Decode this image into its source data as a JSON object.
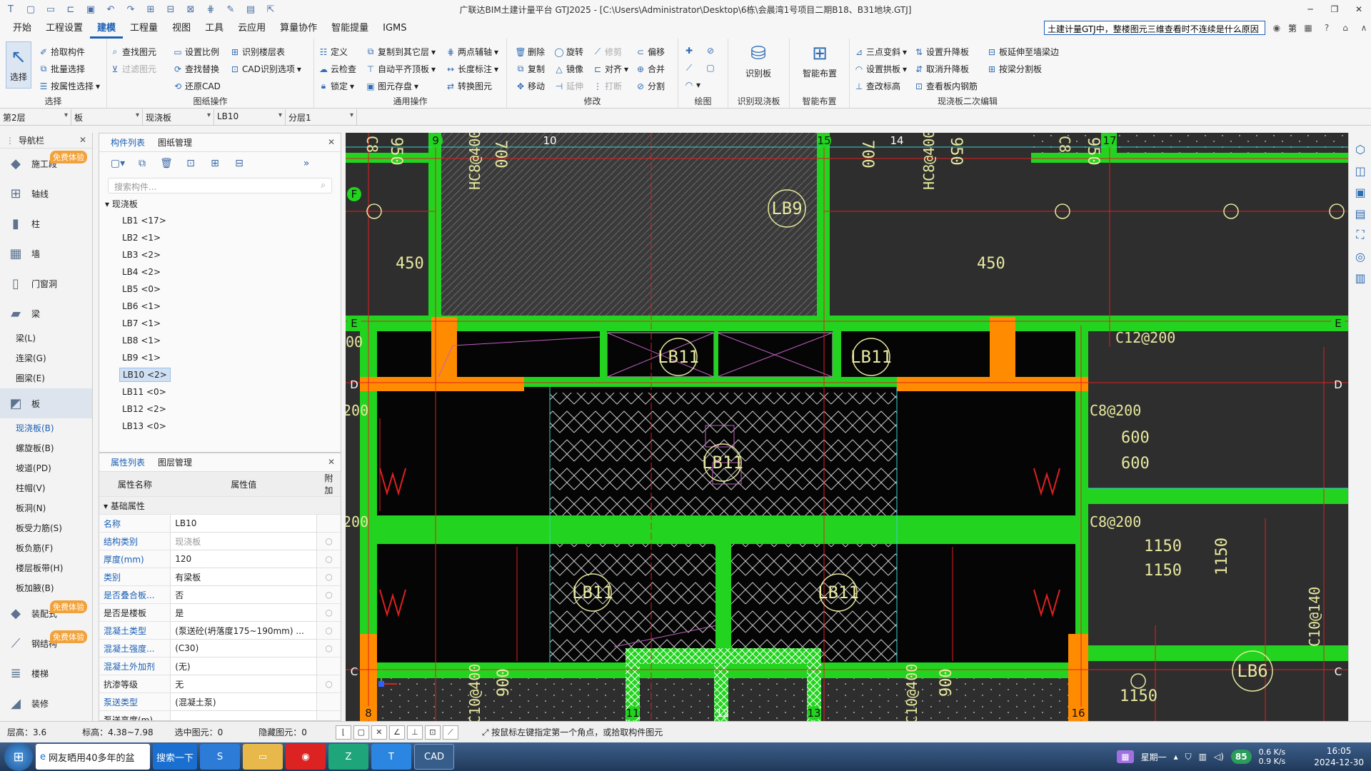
{
  "app": {
    "title": "广联达BIM土建计量平台 GTJ2025 - [C:\\Users\\Administrator\\Desktop\\6栋\\会晨湾1号项目二期B18、B31地块.GTJ]"
  },
  "menu": {
    "items": [
      "开始",
      "工程设置",
      "建模",
      "工程量",
      "视图",
      "工具",
      "云应用",
      "算量协作",
      "智能提量",
      "IGMS"
    ],
    "active": "建模",
    "search_value": "土建计量GTJ中，整楼图元三维查看时不连续是什么原因",
    "user": "第"
  },
  "ribbon": {
    "select": {
      "big": "选择",
      "items": [
        "拾取构件",
        "批量选择",
        "按属性选择"
      ],
      "label": "选择"
    },
    "drawing": {
      "items": [
        "查找图元",
        "过滤图元",
        "设置比例",
        "还原CAD",
        "查找替换",
        "识别楼层表",
        "CAD识别选项"
      ],
      "label": "图纸操作"
    },
    "common": {
      "items": [
        "定义",
        "云检查",
        "锁定",
        "复制到其它层",
        "自动平齐顶板",
        "图元存盘",
        "两点辅轴",
        "长度标注",
        "转换图元"
      ],
      "label": "通用操作"
    },
    "modify": {
      "items": [
        "删除",
        "复制",
        "移动",
        "旋转",
        "镜像",
        "延伸",
        "修剪",
        "对齐",
        "打断",
        "偏移",
        "合并",
        "分割"
      ],
      "label": "修改"
    },
    "draw": {
      "label": "绘图"
    },
    "identify": {
      "big": "识别板",
      "label": "识别现浇板"
    },
    "smart": {
      "big": "智能布置",
      "label": "智能布置"
    },
    "edit2": {
      "items": [
        "三点变斜",
        "设置升降板",
        "板延伸至墙梁边",
        "设置拱板",
        "取消升降板",
        "按梁分割板",
        "查改标高",
        "查看板内钢筋"
      ],
      "label": "现浇板二次编辑"
    }
  },
  "selectors": [
    "第2层",
    "板",
    "现浇板",
    "LB10",
    "分层1"
  ],
  "nav": {
    "title": "导航栏",
    "items": [
      {
        "label": "施工段",
        "badge": "免费体验"
      },
      {
        "label": "轴线"
      },
      {
        "label": "柱"
      },
      {
        "label": "墙"
      },
      {
        "label": "门窗洞"
      },
      {
        "label": "梁"
      }
    ],
    "beam_subs": [
      "梁(L)",
      "连梁(G)",
      "圈梁(E)"
    ],
    "slab": {
      "label": "板"
    },
    "slab_subs": [
      "现浇板(B)",
      "螺旋板(B)",
      "坡道(PD)",
      "柱帽(V)",
      "板洞(N)",
      "板受力筋(S)",
      "板负筋(F)",
      "楼层板带(H)",
      "板加腋(B)"
    ],
    "more": [
      {
        "label": "装配式",
        "badge": "免费体验"
      },
      {
        "label": "钢结构",
        "badge": "免费体验"
      },
      {
        "label": "楼梯"
      },
      {
        "label": "装修"
      }
    ]
  },
  "components": {
    "tabs": [
      "构件列表",
      "图纸管理"
    ],
    "search_placeholder": "搜索构件...",
    "group": "现浇板",
    "items": [
      "LB1 <17>",
      "LB2 <1>",
      "LB3 <2>",
      "LB4 <2>",
      "LB5 <0>",
      "LB6 <1>",
      "LB7 <1>",
      "LB8 <1>",
      "LB9 <1>",
      "LB10 <2>",
      "LB11 <0>",
      "LB12 <2>",
      "LB13 <0>"
    ],
    "selected": "LB10 <2>"
  },
  "properties": {
    "tabs": [
      "属性列表",
      "图层管理"
    ],
    "headers": [
      "属性名称",
      "属性值",
      "附加"
    ],
    "section": "基础属性",
    "rows": [
      {
        "name": "名称",
        "value": "LB10"
      },
      {
        "name": "结构类别",
        "value": "现浇板"
      },
      {
        "name": "厚度(mm)",
        "value": "120"
      },
      {
        "name": "类别",
        "value": "有梁板"
      },
      {
        "name": "是否叠合板...",
        "value": "否"
      },
      {
        "name": "是否是楼板",
        "value": "是"
      },
      {
        "name": "混凝土类型",
        "value": "(泵送砼(坍落度175~190mm) ..."
      },
      {
        "name": "混凝土强度...",
        "value": "(C30)"
      },
      {
        "name": "混凝土外加剂",
        "value": "(无)"
      },
      {
        "name": "抗渗等级",
        "value": "无"
      },
      {
        "name": "泵送类型",
        "value": "(混凝土泵)"
      },
      {
        "name": "泵送高度(m)",
        "value": ""
      }
    ]
  },
  "canvas": {
    "axis_top": [
      "9",
      "10",
      "14",
      "15",
      "17"
    ],
    "axis_bottom": [
      "8",
      "11",
      "12",
      "13",
      "16"
    ],
    "axis_left": [
      "F",
      "E",
      "D",
      "C"
    ],
    "axis_right": [
      "E",
      "D",
      "C"
    ],
    "slab_labels": [
      "LB9",
      "LB11",
      "LB11",
      "LB11",
      "LB11",
      "LB11",
      "LB6"
    ],
    "dims": [
      "450",
      "450",
      "950",
      "700",
      "950",
      "700",
      "950",
      "600",
      "600",
      "1150",
      "1150",
      "1150",
      "1150",
      "900",
      "900"
    ],
    "rebar": [
      "HC8@400",
      "HC8@400",
      "C8",
      "C8",
      "C12@200",
      "C8@200",
      "C8@200",
      "C10@140",
      "C10@400",
      "C10@400",
      "200",
      "200",
      "00"
    ],
    "colors": {
      "beam": "#22d41f",
      "column": "#ff8c00",
      "bg": "#2e2e2e",
      "text": "#e8e8a0"
    }
  },
  "status": {
    "floor_height": "层高：3.6",
    "elevation": "标高：4.38~7.98",
    "selected": "选中图元：0",
    "hidden": "隐藏图元：0",
    "hint": "按鼠标左键指定第一个角点，或拾取构件图元"
  },
  "taskbar": {
    "items": [
      "网友晒用40多年的盆",
      "搜索一下"
    ],
    "tray": {
      "cpu": "85",
      "up": "0.6 K/s",
      "down": "0.9 K/s",
      "time": "16:05",
      "date": "2024-12-30",
      "day": "星期一"
    }
  }
}
